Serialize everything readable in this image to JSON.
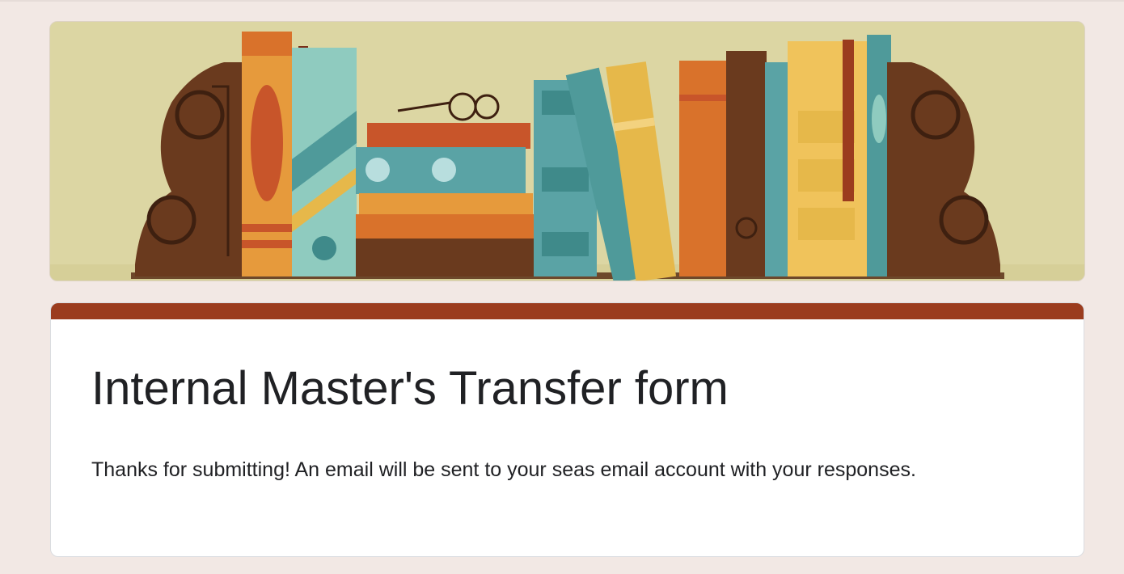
{
  "banner": {
    "theme": "bookshelf-illustration",
    "colors": {
      "background": "#dcd6a3",
      "wood": "#6a3a1e",
      "orange": "#d9722b",
      "teal": "#4f9a9a",
      "mustard": "#e6b84a"
    }
  },
  "form": {
    "accent_color": "#9b3c1e",
    "title": "Internal Master's Transfer form",
    "confirmation_message": "Thanks for submitting! An email will be sent to your seas email account with your responses."
  }
}
